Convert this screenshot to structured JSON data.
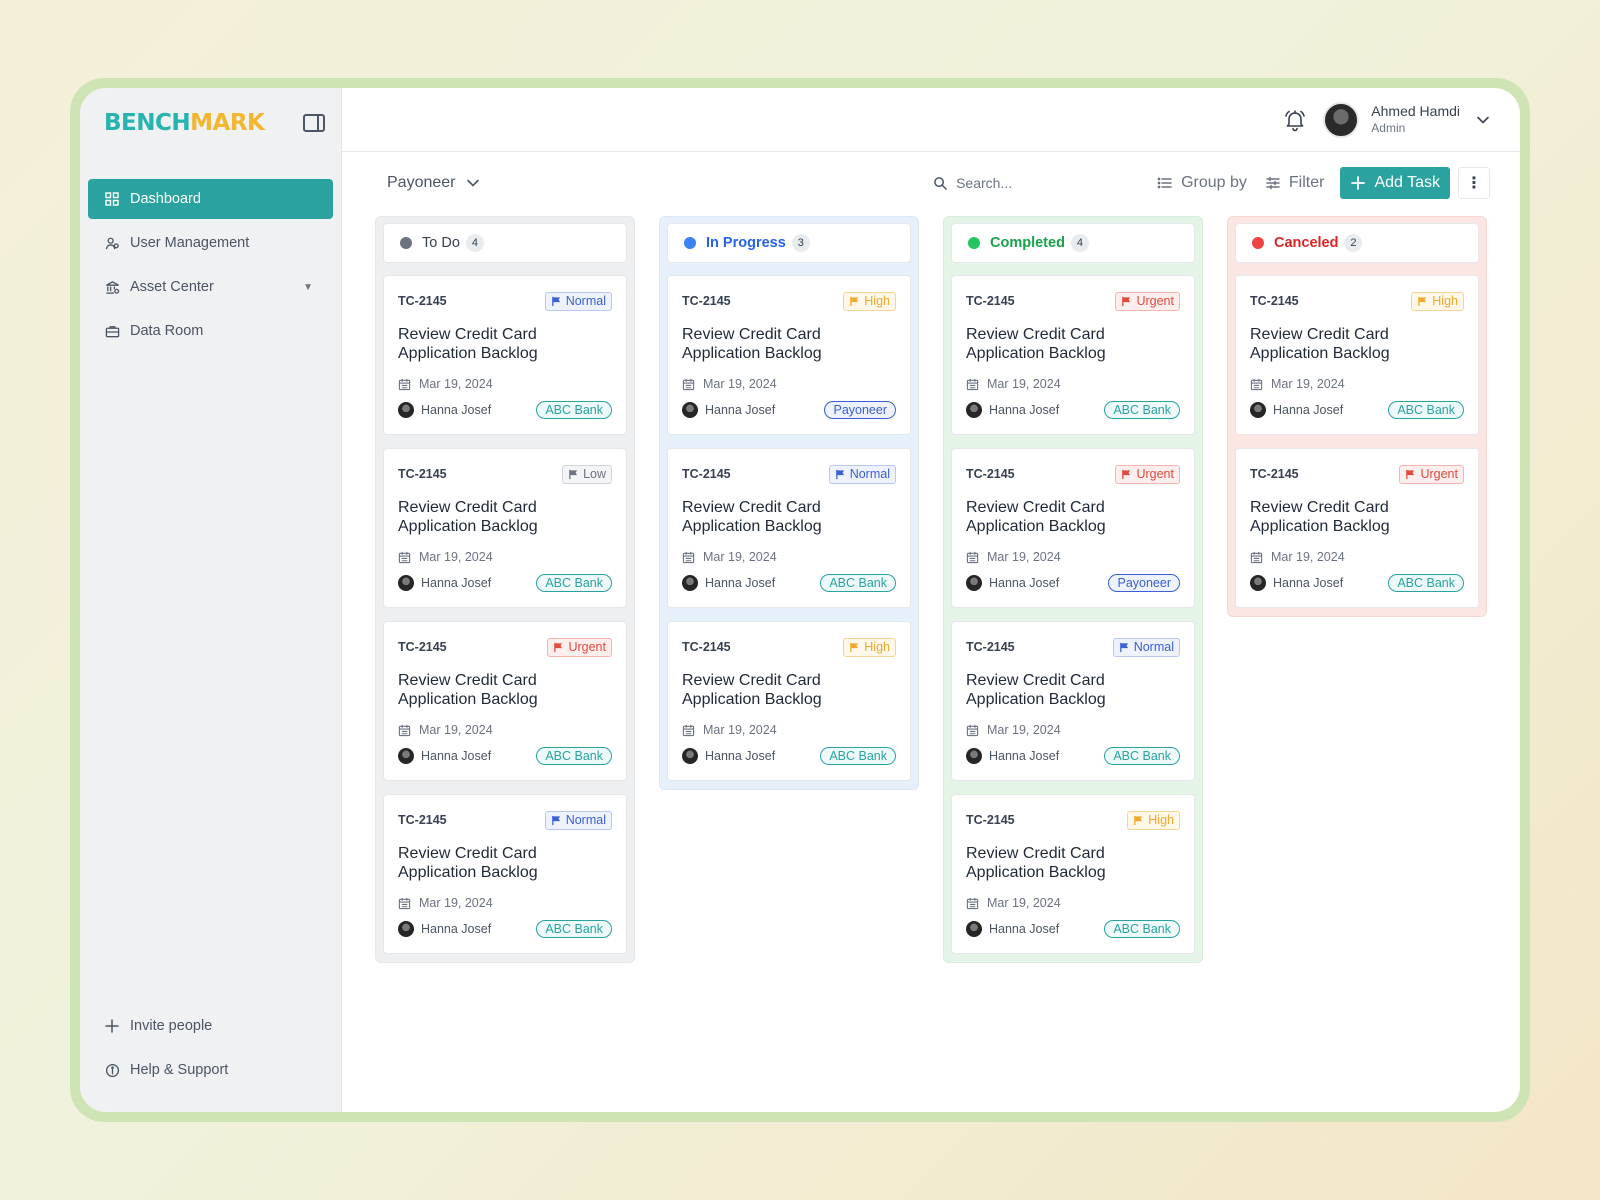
{
  "brand": {
    "logo_part1": "BENCH",
    "logo_part2": "MARK"
  },
  "sidebar": {
    "items": [
      {
        "label": "Dashboard",
        "icon": "grid-icon",
        "active": true
      },
      {
        "label": "User Management",
        "icon": "users-icon"
      },
      {
        "label": "Asset Center",
        "icon": "bank-icon",
        "has_caret": true
      },
      {
        "label": "Data Room",
        "icon": "briefcase-icon"
      }
    ],
    "bottom": [
      {
        "label": "Invite people",
        "icon": "plus-icon"
      },
      {
        "label": "Help & Support",
        "icon": "info-icon"
      }
    ]
  },
  "header": {
    "user_name": "Ahmed Hamdi",
    "user_role": "Admin"
  },
  "toolbar": {
    "workspace": "Payoneer",
    "search_placeholder": "Search...",
    "group_by": "Group by",
    "filter": "Filter",
    "add_task": "Add Task"
  },
  "colors": {
    "accent": "#2aa3a0",
    "todo": "#6b7280",
    "in_progress": "#3b82f6",
    "completed": "#22c55e",
    "canceled": "#ef4444"
  },
  "columns": [
    {
      "key": "todo",
      "title": "To Do",
      "count": "4",
      "cards": [
        {
          "id": "TC-2145",
          "priority": "Normal",
          "title": "Review Credit Card Application Backlog",
          "date": "Mar 19, 2024",
          "assignee": "Hanna Josef",
          "tag": "ABC Bank"
        },
        {
          "id": "TC-2145",
          "priority": "Low",
          "title": "Review Credit Card Application Backlog",
          "date": "Mar 19, 2024",
          "assignee": "Hanna Josef",
          "tag": "ABC Bank"
        },
        {
          "id": "TC-2145",
          "priority": "Urgent",
          "title": "Review Credit Card Application Backlog",
          "date": "Mar 19, 2024",
          "assignee": "Hanna Josef",
          "tag": "ABC Bank"
        },
        {
          "id": "TC-2145",
          "priority": "Normal",
          "title": "Review Credit Card Application Backlog",
          "date": "Mar 19, 2024",
          "assignee": "Hanna Josef",
          "tag": "ABC Bank"
        }
      ]
    },
    {
      "key": "progress",
      "title": "In Progress",
      "count": "3",
      "cards": [
        {
          "id": "TC-2145",
          "priority": "High",
          "title": "Review Credit Card Application Backlog",
          "date": "Mar 19, 2024",
          "assignee": "Hanna Josef",
          "tag": "Payoneer"
        },
        {
          "id": "TC-2145",
          "priority": "Normal",
          "title": "Review Credit Card Application Backlog",
          "date": "Mar 19, 2024",
          "assignee": "Hanna Josef",
          "tag": "ABC Bank"
        },
        {
          "id": "TC-2145",
          "priority": "High",
          "title": "Review Credit Card Application Backlog",
          "date": "Mar 19, 2024",
          "assignee": "Hanna Josef",
          "tag": "ABC Bank"
        }
      ]
    },
    {
      "key": "completed",
      "title": "Completed",
      "count": "4",
      "cards": [
        {
          "id": "TC-2145",
          "priority": "Urgent",
          "title": "Review Credit Card Application Backlog",
          "date": "Mar 19, 2024",
          "assignee": "Hanna Josef",
          "tag": "ABC Bank"
        },
        {
          "id": "TC-2145",
          "priority": "Urgent",
          "title": "Review Credit Card Application Backlog",
          "date": "Mar 19, 2024",
          "assignee": "Hanna Josef",
          "tag": "Payoneer"
        },
        {
          "id": "TC-2145",
          "priority": "Normal",
          "title": "Review Credit Card Application Backlog",
          "date": "Mar 19, 2024",
          "assignee": "Hanna Josef",
          "tag": "ABC Bank"
        },
        {
          "id": "TC-2145",
          "priority": "High",
          "title": "Review Credit Card Application Backlog",
          "date": "Mar 19, 2024",
          "assignee": "Hanna Josef",
          "tag": "ABC Bank"
        }
      ]
    },
    {
      "key": "canceled",
      "title": "Canceled",
      "count": "2",
      "cards": [
        {
          "id": "TC-2145",
          "priority": "High",
          "title": "Review Credit Card Application Backlog",
          "date": "Mar 19, 2024",
          "assignee": "Hanna Josef",
          "tag": "ABC Bank"
        },
        {
          "id": "TC-2145",
          "priority": "Urgent",
          "title": "Review Credit Card Application Backlog",
          "date": "Mar 19, 2024",
          "assignee": "Hanna Josef",
          "tag": "ABC Bank"
        }
      ]
    }
  ]
}
